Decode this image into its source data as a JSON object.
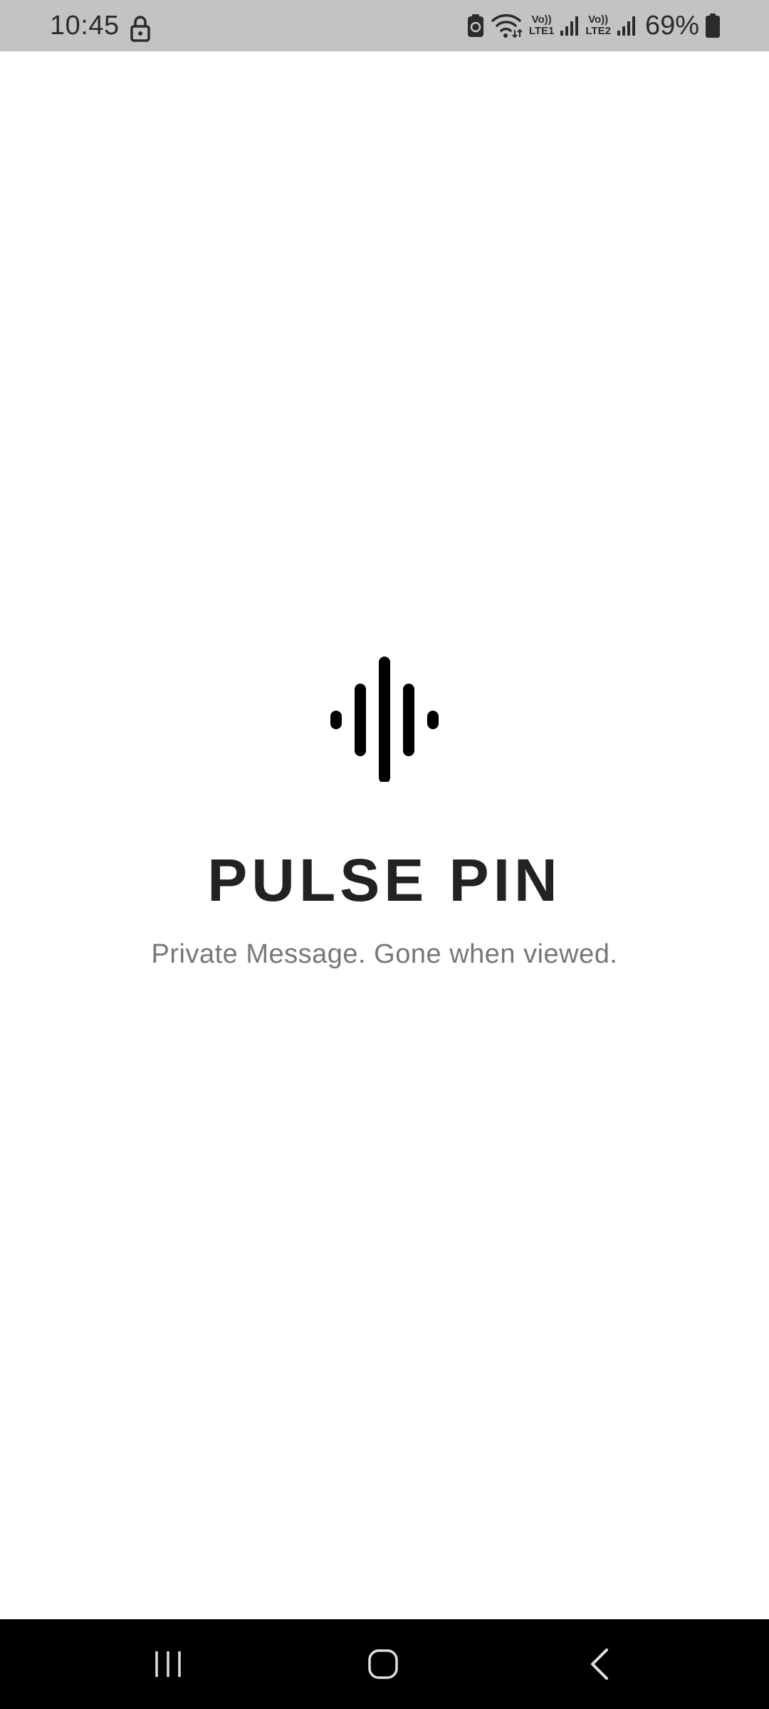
{
  "status_bar": {
    "time": "10:45",
    "network_1": {
      "top": "Vo))",
      "bottom": "LTE1"
    },
    "network_2": {
      "top": "Vo))",
      "bottom": "LTE2"
    },
    "battery_percent": "69%",
    "icons": [
      "lock-icon",
      "battery-saver-icon",
      "wifi-icon",
      "signal-icon",
      "battery-icon"
    ]
  },
  "app": {
    "logo_icon": "sound-wave-icon",
    "title": "PULSE PIN",
    "tagline": "Private Message. Gone when viewed."
  },
  "nav_bar": {
    "buttons": [
      "recent-apps",
      "home",
      "back"
    ]
  },
  "colors": {
    "status_bar_bg": "#c3c3c3",
    "title": "#222222",
    "tagline": "#777777",
    "nav_bar_bg": "#000000"
  }
}
